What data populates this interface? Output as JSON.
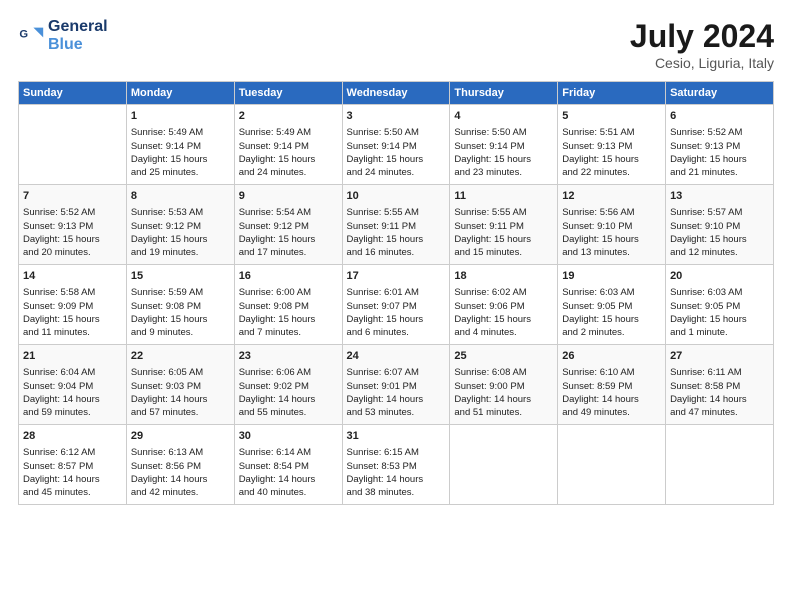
{
  "header": {
    "logo_line1": "General",
    "logo_line2": "Blue",
    "month_year": "July 2024",
    "location": "Cesio, Liguria, Italy"
  },
  "columns": [
    "Sunday",
    "Monday",
    "Tuesday",
    "Wednesday",
    "Thursday",
    "Friday",
    "Saturday"
  ],
  "rows": [
    [
      {
        "day": "",
        "info": ""
      },
      {
        "day": "1",
        "info": "Sunrise: 5:49 AM\nSunset: 9:14 PM\nDaylight: 15 hours\nand 25 minutes."
      },
      {
        "day": "2",
        "info": "Sunrise: 5:49 AM\nSunset: 9:14 PM\nDaylight: 15 hours\nand 24 minutes."
      },
      {
        "day": "3",
        "info": "Sunrise: 5:50 AM\nSunset: 9:14 PM\nDaylight: 15 hours\nand 24 minutes."
      },
      {
        "day": "4",
        "info": "Sunrise: 5:50 AM\nSunset: 9:14 PM\nDaylight: 15 hours\nand 23 minutes."
      },
      {
        "day": "5",
        "info": "Sunrise: 5:51 AM\nSunset: 9:13 PM\nDaylight: 15 hours\nand 22 minutes."
      },
      {
        "day": "6",
        "info": "Sunrise: 5:52 AM\nSunset: 9:13 PM\nDaylight: 15 hours\nand 21 minutes."
      }
    ],
    [
      {
        "day": "7",
        "info": "Sunrise: 5:52 AM\nSunset: 9:13 PM\nDaylight: 15 hours\nand 20 minutes."
      },
      {
        "day": "8",
        "info": "Sunrise: 5:53 AM\nSunset: 9:12 PM\nDaylight: 15 hours\nand 19 minutes."
      },
      {
        "day": "9",
        "info": "Sunrise: 5:54 AM\nSunset: 9:12 PM\nDaylight: 15 hours\nand 17 minutes."
      },
      {
        "day": "10",
        "info": "Sunrise: 5:55 AM\nSunset: 9:11 PM\nDaylight: 15 hours\nand 16 minutes."
      },
      {
        "day": "11",
        "info": "Sunrise: 5:55 AM\nSunset: 9:11 PM\nDaylight: 15 hours\nand 15 minutes."
      },
      {
        "day": "12",
        "info": "Sunrise: 5:56 AM\nSunset: 9:10 PM\nDaylight: 15 hours\nand 13 minutes."
      },
      {
        "day": "13",
        "info": "Sunrise: 5:57 AM\nSunset: 9:10 PM\nDaylight: 15 hours\nand 12 minutes."
      }
    ],
    [
      {
        "day": "14",
        "info": "Sunrise: 5:58 AM\nSunset: 9:09 PM\nDaylight: 15 hours\nand 11 minutes."
      },
      {
        "day": "15",
        "info": "Sunrise: 5:59 AM\nSunset: 9:08 PM\nDaylight: 15 hours\nand 9 minutes."
      },
      {
        "day": "16",
        "info": "Sunrise: 6:00 AM\nSunset: 9:08 PM\nDaylight: 15 hours\nand 7 minutes."
      },
      {
        "day": "17",
        "info": "Sunrise: 6:01 AM\nSunset: 9:07 PM\nDaylight: 15 hours\nand 6 minutes."
      },
      {
        "day": "18",
        "info": "Sunrise: 6:02 AM\nSunset: 9:06 PM\nDaylight: 15 hours\nand 4 minutes."
      },
      {
        "day": "19",
        "info": "Sunrise: 6:03 AM\nSunset: 9:05 PM\nDaylight: 15 hours\nand 2 minutes."
      },
      {
        "day": "20",
        "info": "Sunrise: 6:03 AM\nSunset: 9:05 PM\nDaylight: 15 hours\nand 1 minute."
      }
    ],
    [
      {
        "day": "21",
        "info": "Sunrise: 6:04 AM\nSunset: 9:04 PM\nDaylight: 14 hours\nand 59 minutes."
      },
      {
        "day": "22",
        "info": "Sunrise: 6:05 AM\nSunset: 9:03 PM\nDaylight: 14 hours\nand 57 minutes."
      },
      {
        "day": "23",
        "info": "Sunrise: 6:06 AM\nSunset: 9:02 PM\nDaylight: 14 hours\nand 55 minutes."
      },
      {
        "day": "24",
        "info": "Sunrise: 6:07 AM\nSunset: 9:01 PM\nDaylight: 14 hours\nand 53 minutes."
      },
      {
        "day": "25",
        "info": "Sunrise: 6:08 AM\nSunset: 9:00 PM\nDaylight: 14 hours\nand 51 minutes."
      },
      {
        "day": "26",
        "info": "Sunrise: 6:10 AM\nSunset: 8:59 PM\nDaylight: 14 hours\nand 49 minutes."
      },
      {
        "day": "27",
        "info": "Sunrise: 6:11 AM\nSunset: 8:58 PM\nDaylight: 14 hours\nand 47 minutes."
      }
    ],
    [
      {
        "day": "28",
        "info": "Sunrise: 6:12 AM\nSunset: 8:57 PM\nDaylight: 14 hours\nand 45 minutes."
      },
      {
        "day": "29",
        "info": "Sunrise: 6:13 AM\nSunset: 8:56 PM\nDaylight: 14 hours\nand 42 minutes."
      },
      {
        "day": "30",
        "info": "Sunrise: 6:14 AM\nSunset: 8:54 PM\nDaylight: 14 hours\nand 40 minutes."
      },
      {
        "day": "31",
        "info": "Sunrise: 6:15 AM\nSunset: 8:53 PM\nDaylight: 14 hours\nand 38 minutes."
      },
      {
        "day": "",
        "info": ""
      },
      {
        "day": "",
        "info": ""
      },
      {
        "day": "",
        "info": ""
      }
    ]
  ]
}
